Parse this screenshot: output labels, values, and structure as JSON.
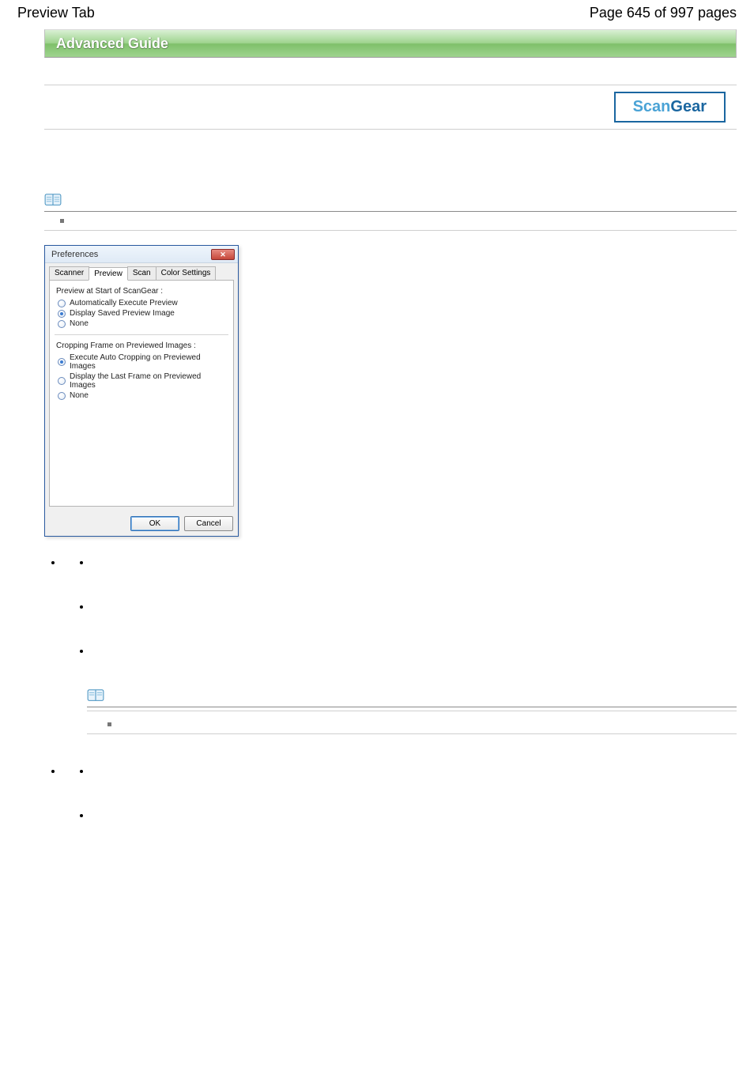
{
  "header": {
    "left": "Preview Tab",
    "right": "Page 645 of 997 pages"
  },
  "banner": {
    "title": "Advanced Guide"
  },
  "brand": {
    "part1": "Scan",
    "part2": "Gear"
  },
  "dialog": {
    "title": "Preferences",
    "close_glyph": "✕",
    "tabs": [
      "Scanner",
      "Preview",
      "Scan",
      "Color Settings"
    ],
    "active_tab_index": 1,
    "group1": {
      "title": "Preview at Start of ScanGear :",
      "options": [
        "Automatically Execute Preview",
        "Display Saved Preview Image",
        "None"
      ],
      "selected_index": 1
    },
    "group2": {
      "title": "Cropping Frame on Previewed Images :",
      "options": [
        "Execute Auto Cropping on Previewed Images",
        "Display the Last Frame on Previewed Images",
        "None"
      ],
      "selected_index": 0
    },
    "ok": "OK",
    "cancel": "Cancel"
  }
}
